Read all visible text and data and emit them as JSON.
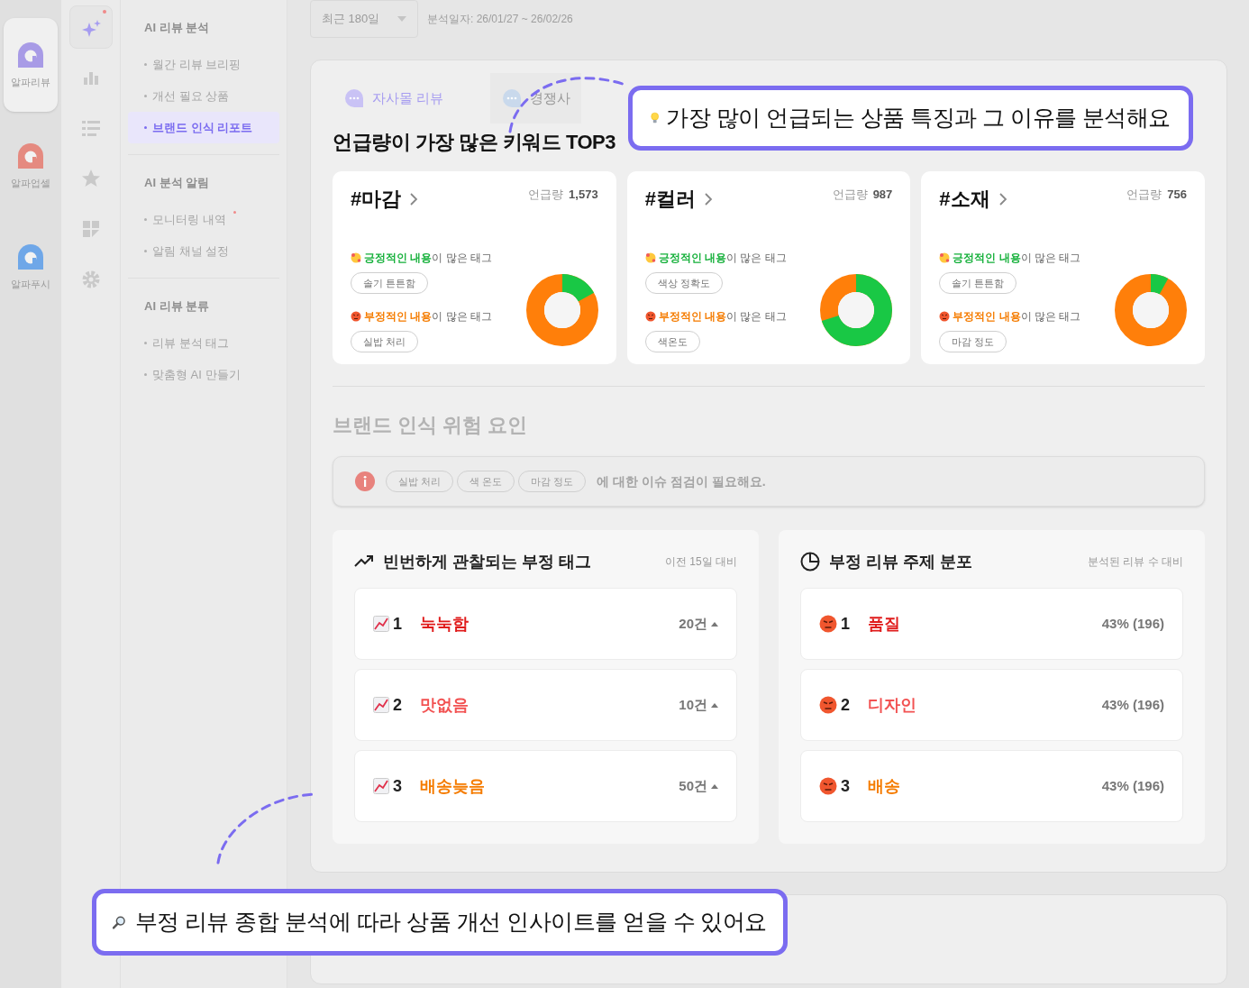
{
  "apps": [
    {
      "label": "알파리뷰",
      "color": "#a89be6",
      "selected": true
    },
    {
      "label": "알파업셀",
      "color": "#e58a80",
      "selected": false
    },
    {
      "label": "알파푸시",
      "color": "#6fa7e8",
      "selected": false
    }
  ],
  "rail_icons": [
    {
      "kind": "sparkle",
      "selected": true,
      "dot": true
    },
    {
      "kind": "bars",
      "selected": false,
      "dot": false
    },
    {
      "kind": "list",
      "selected": false,
      "dot": false
    },
    {
      "kind": "star",
      "selected": false,
      "dot": false
    },
    {
      "kind": "grid",
      "selected": false,
      "dot": false
    },
    {
      "kind": "gear",
      "selected": false,
      "dot": false
    }
  ],
  "nav": [
    {
      "title": "AI 리뷰 분석",
      "items": [
        {
          "label": "월간 리뷰 브리핑",
          "selected": false,
          "dot": false
        },
        {
          "label": "개선 필요 상품",
          "selected": false,
          "dot": false
        },
        {
          "label": "브랜드 인식 리포트",
          "selected": true,
          "dot": false
        }
      ]
    },
    {
      "title": "AI 분석 알림",
      "items": [
        {
          "label": "모니터링 내역",
          "selected": false,
          "dot": true
        },
        {
          "label": "알림 채널 설정",
          "selected": false,
          "dot": false
        }
      ]
    },
    {
      "title": "AI 리뷰 분류",
      "items": [
        {
          "label": "리뷰 분석 태그",
          "selected": false,
          "dot": false
        },
        {
          "label": "맞춤형 AI 만들기",
          "selected": false,
          "dot": false
        }
      ]
    }
  ],
  "period": {
    "value": "최근 180일",
    "caption": "분석일자: 26/01/27 ~ 26/02/26"
  },
  "tabs": [
    {
      "label": "자사몰 리뷰",
      "kind": "chat",
      "selected": true
    },
    {
      "label": "경쟁사",
      "kind": "chat",
      "selected": false
    }
  ],
  "keywords_title": "언급량이 가장 많은 키워드 TOP3",
  "keywords": [
    {
      "name": "#마감",
      "mentions_label": "언급량",
      "mentions": "1,573",
      "positive_label": "**긍정적인 내용**이 많은 태그",
      "positive_tags": [
        "솔기 튼튼함"
      ],
      "negative_label": "**부정적인 내용**이 많은 태그",
      "negative_tags": [
        "실밥 처리"
      ],
      "level": 0.17
    },
    {
      "name": "#컬러",
      "mentions_label": "언급량",
      "mentions": "987",
      "positive_label": "**긍정적인 내용**이 많은 태그",
      "positive_tags": [
        "색상 정확도"
      ],
      "negative_label": "**부정적인 내용**이 많은 태그",
      "negative_tags": [
        "색온도"
      ],
      "level": 0.7
    },
    {
      "name": "#소재",
      "mentions_label": "언급량",
      "mentions": "756",
      "positive_label": "**긍정적인 내용**이 많은 태그",
      "positive_tags": [
        "솔기 튼튼함"
      ],
      "negative_label": "**부정적인 내용**이 많은 태그",
      "negative_tags": [
        "마감 정도"
      ],
      "level": 0.08
    }
  ],
  "risk": {
    "title": "브랜드 인식 위험 요인",
    "tags": [
      "실밥 처리",
      "색 온도",
      "마감 정도"
    ],
    "message": "에 대한 이슈 점검이 필요해요."
  },
  "panels": [
    {
      "kind": "trend",
      "title": "빈번하게 관찰되는 부정 태그",
      "note": "이전 15일 대비",
      "rows": [
        {
          "rank": "1",
          "label": "눅눅함",
          "value": "20건",
          "color": "#e01b1b",
          "up": true
        },
        {
          "rank": "2",
          "label": "맛없음",
          "value": "10건",
          "color": "#f25252",
          "up": true
        },
        {
          "rank": "3",
          "label": "배송늦음",
          "value": "50건",
          "color": "#f57c00",
          "up": true
        }
      ]
    },
    {
      "kind": "pie",
      "title": "부정 리뷰 주제 분포",
      "note": "분석된 리뷰 수 대비",
      "rows": [
        {
          "rank": "1",
          "label": "품질",
          "value": "43% (196)",
          "color": "#e01b1b",
          "up": false
        },
        {
          "rank": "2",
          "label": "디자인",
          "value": "43% (196)",
          "color": "#f25252",
          "up": false
        },
        {
          "rank": "3",
          "label": "배송",
          "value": "43% (196)",
          "color": "#f57c00",
          "up": false
        }
      ]
    }
  ],
  "callouts": [
    {
      "kind": "bulb",
      "text": "가장 많이 언급되는 상품 특징과 그 이유를 분석해요"
    },
    {
      "kind": "magnifier",
      "text": "부정 리뷰 종합 분석에 따라 상품 개선 인사이트를 얻을 수 있어요"
    }
  ]
}
